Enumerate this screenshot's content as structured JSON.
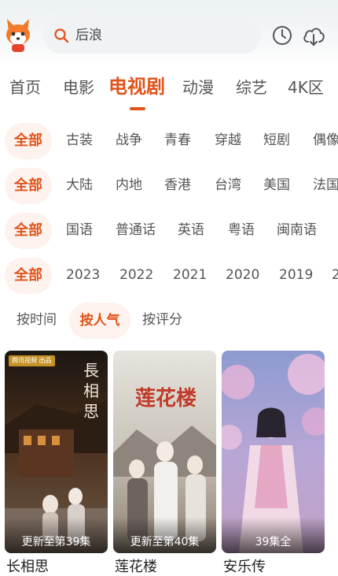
{
  "search": {
    "query": "后浪"
  },
  "icons": {
    "logo": "fox-logo-icon",
    "search": "search-icon",
    "history": "clock-icon",
    "download": "cloud-download-icon"
  },
  "tabs": [
    "首页",
    "电影",
    "电视剧",
    "动漫",
    "综艺",
    "4K区"
  ],
  "active_tab": "电视剧",
  "filters": {
    "all_label": "全部",
    "genre": [
      "古装",
      "战争",
      "青春",
      "穿越",
      "短剧",
      "偶像"
    ],
    "region": [
      "大陆",
      "内地",
      "香港",
      "台湾",
      "美国",
      "法国"
    ],
    "language": [
      "国语",
      "普通话",
      "英语",
      "粤语",
      "闽南语"
    ],
    "year": [
      "2023",
      "2022",
      "2021",
      "2020",
      "2019",
      "2"
    ]
  },
  "sort": {
    "options": [
      "按时间",
      "按人气",
      "按评分"
    ],
    "active": "按人气"
  },
  "cards": [
    {
      "title": "长相思",
      "episode": "更新至第39集",
      "poster_title": "長相思",
      "badge": "腾讯视频 出品"
    },
    {
      "title": "莲花楼",
      "episode": "更新至第40集",
      "poster_title": "莲花楼"
    },
    {
      "title": "安乐传",
      "episode": "39集全"
    }
  ],
  "colors": {
    "accent": "#e0531a",
    "chip_bg": "#fdf2ed",
    "text": "#555555"
  }
}
